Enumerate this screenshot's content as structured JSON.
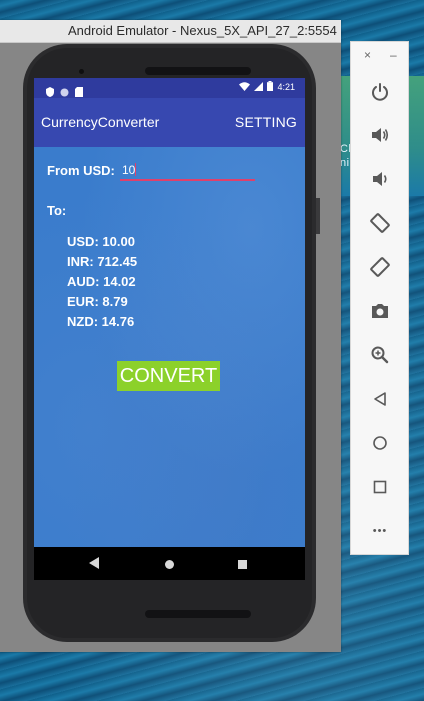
{
  "emulator": {
    "title": "Android Emulator - Nexus_5X_API_27_2:5554"
  },
  "desktop": {
    "partial_text": "Cl        o\nni"
  },
  "status_bar": {
    "time": "4:21"
  },
  "app_bar": {
    "title": "CurrencyConverter",
    "setting_label": "SETTING"
  },
  "form": {
    "from_label": "From USD:",
    "amount_value": "10",
    "to_label": "To:"
  },
  "results": {
    "items": [
      {
        "label": "USD: 10.00"
      },
      {
        "label": "INR: 712.45"
      },
      {
        "label": "AUD: 14.02"
      },
      {
        "label": "EUR: 8.79"
      },
      {
        "label": "NZD: 14.76"
      }
    ]
  },
  "actions": {
    "convert_label": "CONVERT"
  },
  "side_panel": {
    "close_label": "×",
    "min_label": "–",
    "more_label": "•••"
  },
  "icons": {
    "power": "power-icon",
    "volume_up": "volume-up-icon",
    "volume_down": "volume-down-icon",
    "rotate_left": "rotate-left-icon",
    "rotate_right": "rotate-right-icon",
    "camera": "camera-icon",
    "zoom": "zoom-icon",
    "back": "back-icon",
    "home": "home-icon",
    "overview": "overview-icon",
    "more": "more-icon"
  },
  "colors": {
    "status_bar": "#2f3b9e",
    "app_bar": "#3748b0",
    "content_bg": "#3a7ccc",
    "input_underline": "#e0406b",
    "convert_button": "#8cd12a"
  }
}
